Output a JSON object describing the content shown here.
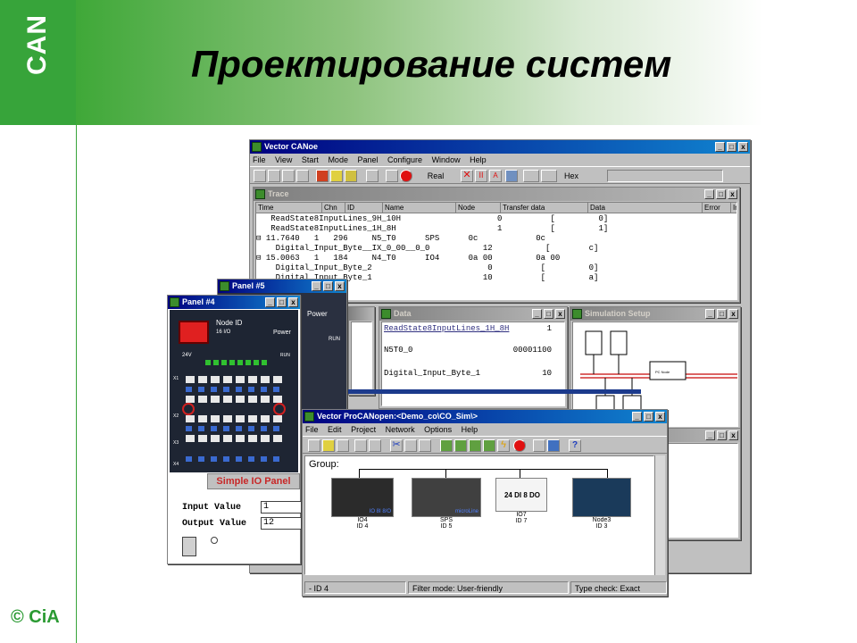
{
  "slide": {
    "title": "Проектирование систем",
    "logo": "CAN",
    "copyright": "© CiA"
  },
  "canoe": {
    "title": "Vector CANoe",
    "menu": [
      "File",
      "View",
      "Start",
      "Mode",
      "Panel",
      "Configure",
      "Window",
      "Help"
    ],
    "toolbar": {
      "mode": "Real",
      "format": "Hex"
    }
  },
  "trace": {
    "title": "Trace",
    "columns": [
      "Time",
      "Chn",
      "ID",
      "Name",
      "Node",
      "Transfer data",
      "Data",
      "Error",
      "In"
    ],
    "rows": [
      "   ReadState8InputLines_9H_10H                    0          [         0]",
      "   ReadState8InputLines_1H_8H                     1          [         1]",
      "⊟ 11.7640   1   296     N5_T0      SPS      0c            0c",
      "    Digital_Input_Byte__IX_0_00__0_0           12           [        c]",
      "⊟ 15.0063   1   184     N4_T0      IO4      0a 00         0a 00",
      "    Digital_Input_Byte_2                        0          [         0]",
      "    Digital_Input_Byte_1                       10          [         a]"
    ]
  },
  "panel5": {
    "title": "Panel #5",
    "power": "Power",
    "run": "RUN"
  },
  "panel4": {
    "title": "Panel #4",
    "node_id": "Node ID",
    "node_sub": "16 I/O",
    "power": "Power",
    "v24": "24V",
    "run": "RUN",
    "caption": "Simple IO Panel",
    "input_label": "Input Value",
    "input_value": "1",
    "output_label": "Output Value",
    "output_value": "12",
    "row_labels": [
      "X1",
      "X2",
      "X3",
      "X4"
    ]
  },
  "data_win": {
    "title": "Data",
    "rows": [
      {
        "name": "ReadState8InputLines_1H_8H",
        "value": "1"
      },
      {
        "name": "N5T0_0",
        "value": "00001100"
      },
      {
        "name": "Digital_Input_Byte_1",
        "value": "10"
      }
    ]
  },
  "sim": {
    "title": "Simulation Setup",
    "node_label": "PC Node"
  },
  "procanopen": {
    "title": "Vector ProCANopen:<Demo_co\\CO_Sim\\>",
    "menu": [
      "File",
      "Edit",
      "Project",
      "Network",
      "Options",
      "Help"
    ],
    "group_label": "Group:",
    "devices": [
      {
        "name": "IO4",
        "id": "ID 4",
        "img_label": "IO 8I 8/O"
      },
      {
        "name": "SPS",
        "id": "ID 5",
        "img_label": "microLine"
      },
      {
        "name": "IO7",
        "id": "ID 7",
        "img_label": "24 DI 8 DO"
      },
      {
        "name": "Node3",
        "id": "ID 3",
        "img_label": ""
      }
    ],
    "status": [
      "- ID 4",
      "Filter mode: User-friendly",
      "Type check: Exact"
    ]
  },
  "colors": {
    "green": "#37a43a",
    "titlebar": "#000080",
    "panel_caption": "#c82828"
  }
}
